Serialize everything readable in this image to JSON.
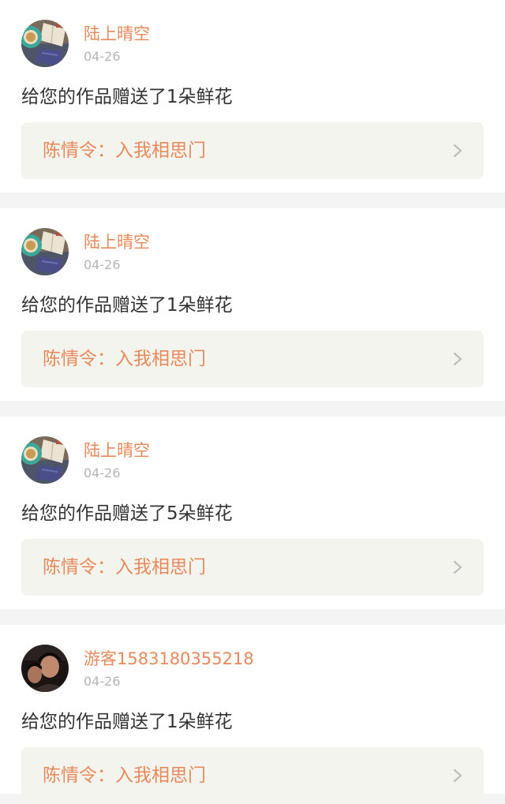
{
  "colors": {
    "accent": "#e8895c",
    "date_text": "#b5b5b5",
    "body_text": "#333333",
    "card_background": "#ffffff",
    "link_background": "#f4f4ee",
    "page_background": "#f4f4f4"
  },
  "notifications": [
    {
      "username": "陆上晴空",
      "date": "04-26",
      "message": "给您的作品赠送了1朵鲜花",
      "work_title": "陈情令：入我相思门",
      "avatar_icon": "teacup-book-avatar",
      "link_icon": "chevron-right-icon"
    },
    {
      "username": "陆上晴空",
      "date": "04-26",
      "message": "给您的作品赠送了1朵鲜花",
      "work_title": "陈情令：入我相思门",
      "avatar_icon": "teacup-book-avatar",
      "link_icon": "chevron-right-icon"
    },
    {
      "username": "陆上晴空",
      "date": "04-26",
      "message": "给您的作品赠送了5朵鲜花",
      "work_title": "陈情令：入我相思门",
      "avatar_icon": "teacup-book-avatar",
      "link_icon": "chevron-right-icon"
    },
    {
      "username": "游客1583180355218",
      "date": "04-26",
      "message": "给您的作品赠送了1朵鲜花",
      "work_title": "陈情令：入我相思门",
      "avatar_icon": "person-photo-avatar",
      "link_icon": "chevron-right-icon"
    }
  ]
}
